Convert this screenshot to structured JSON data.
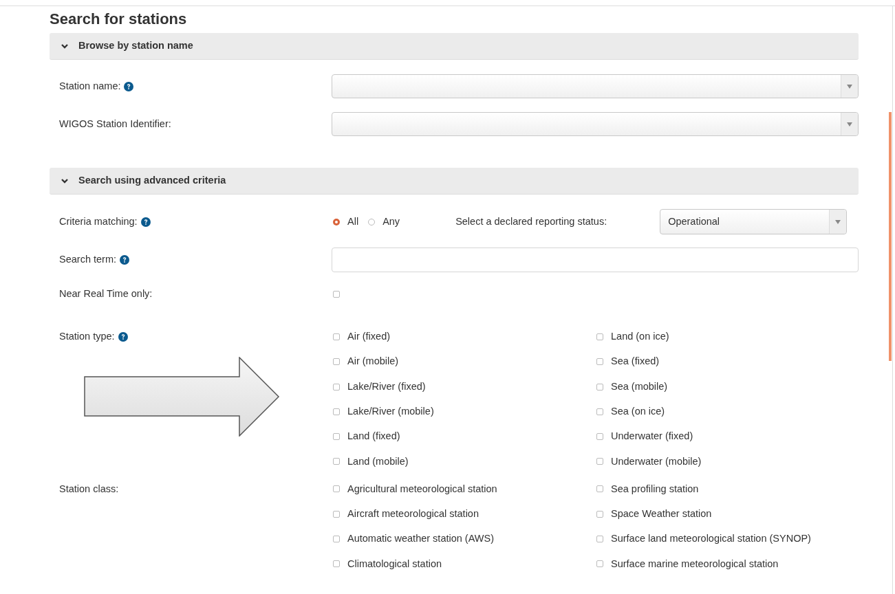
{
  "heading": "Search for stations",
  "sections": [
    {
      "title": "Browse by station name",
      "expanded": true,
      "rows": [
        {
          "kind": "select",
          "label": "Station name:",
          "help": true
        },
        {
          "kind": "select",
          "label": "WIGOS Station Identifier:",
          "help": false
        }
      ]
    },
    {
      "title": "Search using advanced criteria",
      "expanded": true,
      "rows": [
        {
          "kind": "matching",
          "label": "Criteria matching:",
          "help": true,
          "options": [
            {
              "label": "All",
              "selected": true
            },
            {
              "label": "Any",
              "selected": false
            }
          ],
          "status_label": "Select a declared reporting status:",
          "status_value": "Operational"
        },
        {
          "kind": "text",
          "label": "Search term:",
          "help": true
        },
        {
          "kind": "checkbox",
          "label": "Near Real Time only:",
          "help": false,
          "checked": false
        },
        {
          "kind": "checkgrid",
          "label": "Station type:",
          "help": true,
          "items": [
            {
              "label": "Air (fixed)",
              "checked": false
            },
            {
              "label": "Land (on ice)",
              "checked": false
            },
            {
              "label": "Air (mobile)",
              "checked": false
            },
            {
              "label": "Sea (fixed)",
              "checked": false
            },
            {
              "label": "Lake/River (fixed)",
              "checked": false
            },
            {
              "label": "Sea (mobile)",
              "checked": false
            },
            {
              "label": "Lake/River (mobile)",
              "checked": false
            },
            {
              "label": "Sea (on ice)",
              "checked": false
            },
            {
              "label": "Land (fixed)",
              "checked": false
            },
            {
              "label": "Underwater (fixed)",
              "checked": false
            },
            {
              "label": "Land (mobile)",
              "checked": false
            },
            {
              "label": "Underwater (mobile)",
              "checked": false
            }
          ]
        },
        {
          "kind": "checkgrid",
          "label": "Station class:",
          "help": false,
          "items": [
            {
              "label": "Agricultural meteorological station",
              "checked": false
            },
            {
              "label": "Sea profiling station",
              "checked": false
            },
            {
              "label": "Aircraft meteorological station",
              "checked": false
            },
            {
              "label": "Space Weather station",
              "checked": false
            },
            {
              "label": "Automatic weather station (AWS)",
              "checked": false
            },
            {
              "label": "Surface land meteorological station (SYNOP)",
              "checked": false
            },
            {
              "label": "Climatological station",
              "checked": false
            },
            {
              "label": "Surface marine meteorological station",
              "checked": false
            }
          ]
        }
      ]
    }
  ]
}
